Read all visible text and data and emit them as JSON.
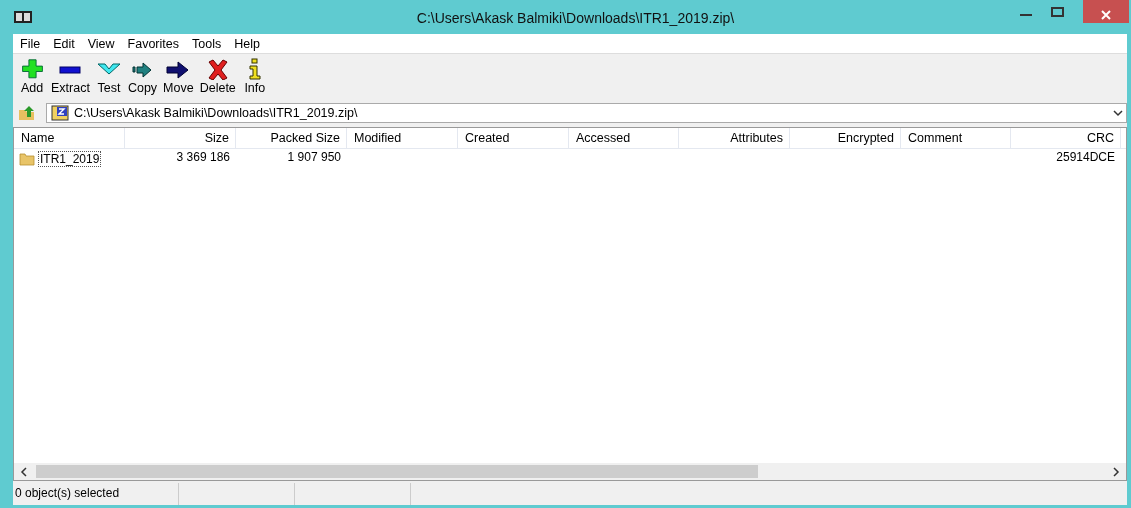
{
  "window": {
    "title": "C:\\Users\\Akask Balmiki\\Downloads\\ITR1_2019.zip\\"
  },
  "menu": [
    "File",
    "Edit",
    "View",
    "Favorites",
    "Tools",
    "Help"
  ],
  "toolbar": [
    {
      "kind": "add",
      "label": "Add"
    },
    {
      "kind": "extract",
      "label": "Extract"
    },
    {
      "kind": "test",
      "label": "Test"
    },
    {
      "kind": "copy",
      "label": "Copy"
    },
    {
      "kind": "move",
      "label": "Move"
    },
    {
      "kind": "delete",
      "label": "Delete"
    },
    {
      "kind": "info",
      "label": "Info"
    }
  ],
  "address": {
    "value": "C:\\Users\\Akask Balmiki\\Downloads\\ITR1_2019.zip\\"
  },
  "table": {
    "columns": [
      "Name",
      "Size",
      "Packed Size",
      "Modified",
      "Created",
      "Accessed",
      "Attributes",
      "Encrypted",
      "Comment",
      "CRC"
    ],
    "rows": [
      {
        "kind": "folder",
        "focused": true,
        "cells": [
          "ITR1_2019",
          "3 369 186",
          "1 907 950",
          "",
          "",
          "",
          "",
          "",
          "",
          "25914DCE"
        ]
      }
    ]
  },
  "status_bar": [
    "0 object(s) selected"
  ]
}
